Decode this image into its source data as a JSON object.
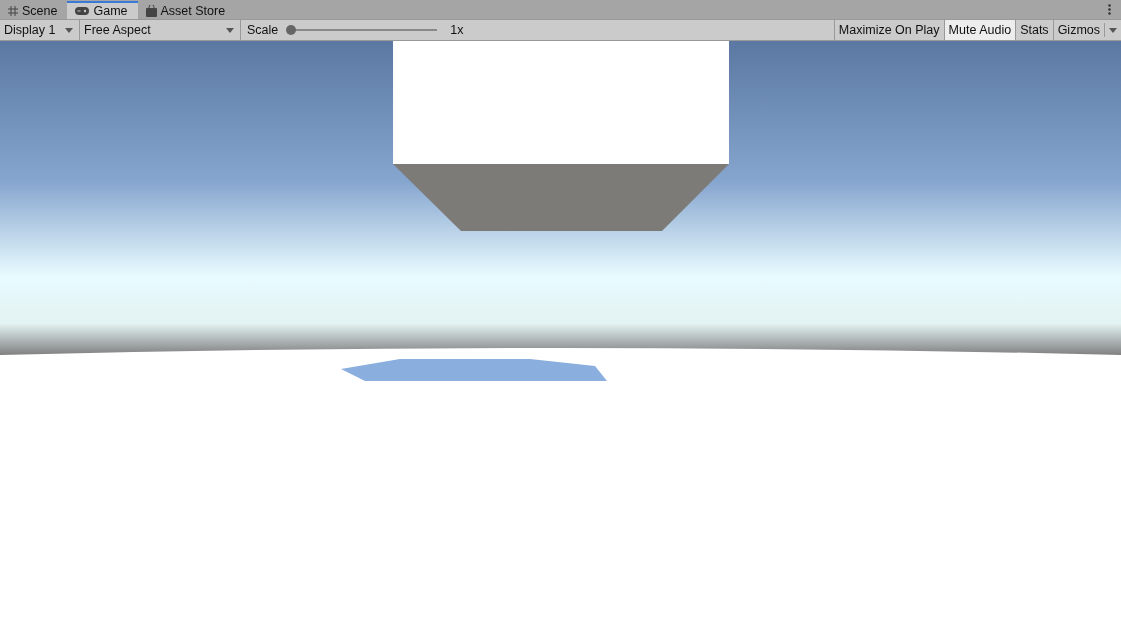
{
  "tabs": [
    {
      "label": "Scene",
      "kind": "grid",
      "selected": false
    },
    {
      "label": "Game",
      "kind": "gamepad",
      "selected": true
    },
    {
      "label": "Asset Store",
      "kind": "bag",
      "selected": false
    }
  ],
  "toolbar": {
    "display": "Display 1",
    "aspect": "Free Aspect",
    "scale": {
      "label": "Scale",
      "level": 0,
      "reading": "1x"
    },
    "toggles": [
      {
        "label": "Maximize On Play",
        "on": false
      },
      {
        "label": "Mute Audio",
        "on": true
      },
      {
        "label": "Stats",
        "on": false
      }
    ],
    "gizmos": "Gizmos"
  }
}
